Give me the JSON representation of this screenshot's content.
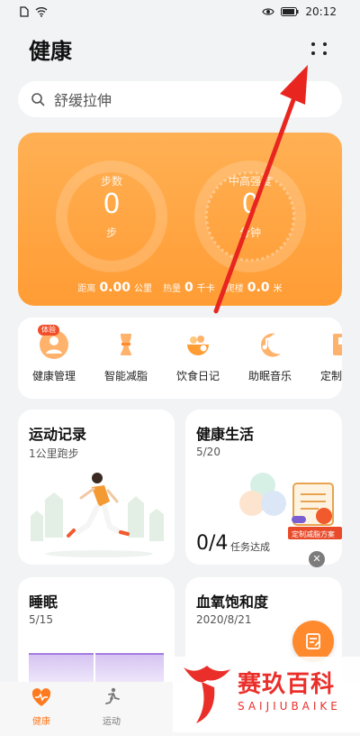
{
  "status_bar": {
    "time": "20:12"
  },
  "header": {
    "title": "健康"
  },
  "search": {
    "placeholder": "舒缓拉伸"
  },
  "activity": {
    "steps": {
      "label": "步数",
      "value": "0",
      "unit": "步"
    },
    "intensity": {
      "label": "中高强度",
      "value": "0",
      "unit": "分钟"
    },
    "stats": [
      {
        "label": "距离",
        "value": "0.00",
        "unit": "公里"
      },
      {
        "label": "热量",
        "value": "0",
        "unit": "千卡"
      },
      {
        "label": "爬楼",
        "value": "0.0",
        "unit": "米"
      }
    ]
  },
  "services": {
    "items": [
      {
        "label": "健康管理",
        "badge": "体验"
      },
      {
        "label": "智能减脂"
      },
      {
        "label": "饮食日记"
      },
      {
        "label": "助眠音乐"
      },
      {
        "label": "定制"
      }
    ]
  },
  "cards": {
    "exercise": {
      "title": "运动记录",
      "subtitle": "1公里跑步"
    },
    "life": {
      "title": "健康生活",
      "subtitle": "5/20",
      "progress": "0/4",
      "progress_label": "任务达成",
      "banner": "定制减脂方案"
    },
    "sleep": {
      "title": "睡眠",
      "subtitle": "5/15"
    },
    "spo2": {
      "title": "血氧饱和度",
      "subtitle": "2020/8/21"
    }
  },
  "bottom_nav": {
    "items": [
      {
        "label": "健康",
        "active": true
      },
      {
        "label": "运动",
        "active": false
      }
    ]
  },
  "watermark": {
    "title": "赛玖百科",
    "subtitle": "SAIJIUBAIKE"
  },
  "colors": {
    "accent": "#ff9c34",
    "arrow": "#e8261f",
    "watermark": "#ea2f2a"
  }
}
